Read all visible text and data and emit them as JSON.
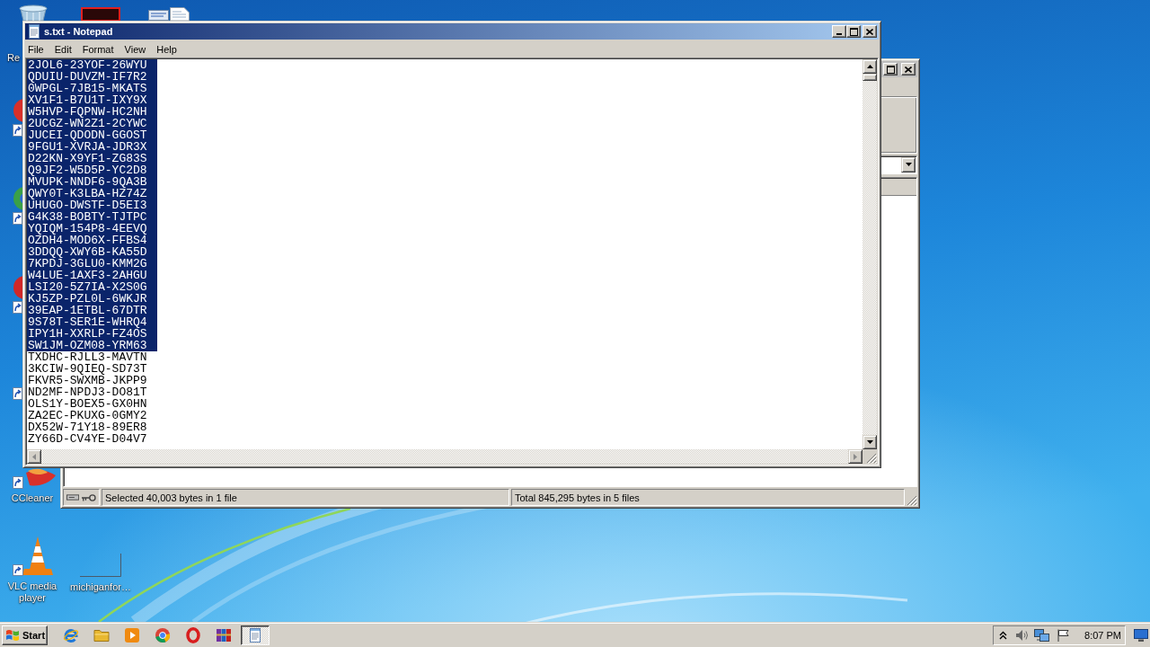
{
  "desktop_icons": [
    {
      "label": "Re"
    },
    {
      "label": "CCleaner"
    },
    {
      "label": "VLC media player"
    },
    {
      "label": "michiganfor…"
    }
  ],
  "archive_window": {
    "active": false,
    "status_bar": [
      "Selected 40,003 bytes in 1 file",
      "Total 845,295 bytes in 5 files"
    ]
  },
  "notepad": {
    "active": true,
    "title": "s.txt - Notepad",
    "menu": [
      "File",
      "Edit",
      "Format",
      "View",
      "Help"
    ],
    "lines": [
      {
        "text": "2JOL6-23YOF-26WYU",
        "selected": true
      },
      {
        "text": "QDUIU-DUVZM-IF7R2",
        "selected": true
      },
      {
        "text": "0WPGL-7JB15-MKATS",
        "selected": true
      },
      {
        "text": "XV1F1-B7U1T-IXY9X",
        "selected": true
      },
      {
        "text": "W5HVP-FQPNW-HC2NH",
        "selected": true
      },
      {
        "text": "2UCGZ-WN2Z1-2CYWC",
        "selected": true
      },
      {
        "text": "JUCEI-QDODN-GGOST",
        "selected": true
      },
      {
        "text": "9FGU1-XVRJA-JDR3X",
        "selected": true
      },
      {
        "text": "D22KN-X9YF1-ZG83S",
        "selected": true
      },
      {
        "text": "Q9JF2-W5D5P-YC2D8",
        "selected": true
      },
      {
        "text": "MVUPK-NNDF6-9QA3B",
        "selected": true
      },
      {
        "text": "QWY0T-K3LBA-HZ74Z",
        "selected": true
      },
      {
        "text": "UHUGO-DWSTF-D5EI3",
        "selected": true
      },
      {
        "text": "G4K38-BOBTY-TJTPC",
        "selected": true
      },
      {
        "text": "YQIQM-154P8-4EEVQ",
        "selected": true
      },
      {
        "text": "OZDH4-MOD6X-FFBS4",
        "selected": true
      },
      {
        "text": "3DDQQ-XWY6B-KA55D",
        "selected": true
      },
      {
        "text": "7KPDJ-3GLU0-KMM2G",
        "selected": true
      },
      {
        "text": "W4LUE-1AXF3-2AHGU",
        "selected": true
      },
      {
        "text": "LSI20-5Z7IA-X2S0G",
        "selected": true
      },
      {
        "text": "KJ5ZP-PZL0L-6WKJR",
        "selected": true
      },
      {
        "text": "39EAP-1ETBL-67DTR",
        "selected": true
      },
      {
        "text": "9S78T-SER1E-WHRQ4",
        "selected": true
      },
      {
        "text": "IPY1H-XXRLP-FZ4OS",
        "selected": true
      },
      {
        "text": "SW1JM-OZM08-YRM63",
        "selected": true
      },
      {
        "text": "TXDHC-RJLL3-MAVTN",
        "selected": false
      },
      {
        "text": "3KCIW-9QIEQ-SD73T",
        "selected": false
      },
      {
        "text": "FKVR5-SWXMB-JKPP9",
        "selected": false
      },
      {
        "text": "ND2MF-NPDJ3-DO81T",
        "selected": false
      },
      {
        "text": "OLS1Y-BOEX5-GX0HN",
        "selected": false
      },
      {
        "text": "ZA2EC-PKUXG-0GMY2",
        "selected": false
      },
      {
        "text": "DX52W-71Y18-89ER8",
        "selected": false
      },
      {
        "text": "ZY66D-CV4YE-D04V7",
        "selected": false
      }
    ]
  },
  "taskbar": {
    "start": "Start",
    "open_window": {
      "selected": true
    },
    "clock": "8:07 PM"
  }
}
